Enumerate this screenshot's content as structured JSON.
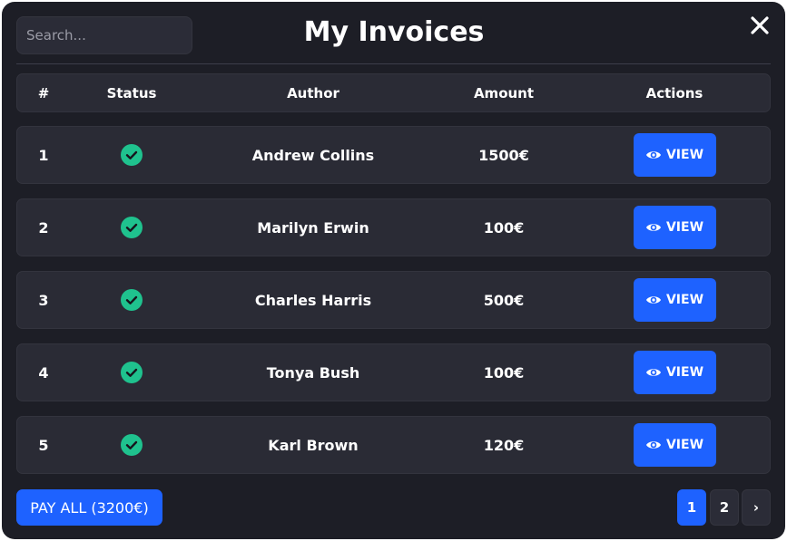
{
  "modal": {
    "title": "My Invoices",
    "close_icon": "close-icon"
  },
  "search": {
    "placeholder": "Search...",
    "value": ""
  },
  "table": {
    "headers": {
      "num": "#",
      "status": "Status",
      "author": "Author",
      "amount": "Amount",
      "actions": "Actions"
    },
    "rows": [
      {
        "num": "1",
        "status_icon": "check-circle-icon",
        "author": "Andrew Collins",
        "amount": "1500€",
        "action_label": "VIEW",
        "action_icon": "eye-icon"
      },
      {
        "num": "2",
        "status_icon": "check-circle-icon",
        "author": "Marilyn Erwin",
        "amount": "100€",
        "action_label": "VIEW",
        "action_icon": "eye-icon"
      },
      {
        "num": "3",
        "status_icon": "check-circle-icon",
        "author": "Charles Harris",
        "amount": "500€",
        "action_label": "VIEW",
        "action_icon": "eye-icon"
      },
      {
        "num": "4",
        "status_icon": "check-circle-icon",
        "author": "Tonya Bush",
        "amount": "100€",
        "action_label": "VIEW",
        "action_icon": "eye-icon"
      },
      {
        "num": "5",
        "status_icon": "check-circle-icon",
        "author": "Karl Brown",
        "amount": "120€",
        "action_label": "VIEW",
        "action_icon": "eye-icon"
      }
    ]
  },
  "footer": {
    "pay_all_label": "PAY ALL (3200€)",
    "pagination": {
      "pages": [
        "1",
        "2"
      ],
      "current": "1",
      "next_label": "›"
    }
  },
  "colors": {
    "background": "#1d1e26",
    "row": "#2a2b35",
    "accent": "#1e62ff",
    "success": "#1fc28e",
    "text": "#ffffff"
  }
}
